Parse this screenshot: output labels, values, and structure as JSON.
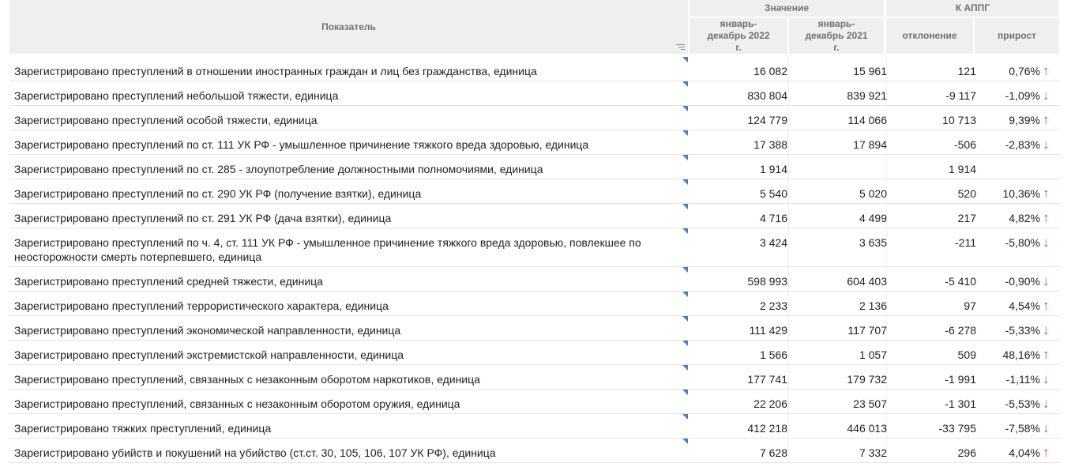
{
  "header": {
    "indicator": "Показатель",
    "value_group": "Значение",
    "appg_group": "К АППГ",
    "period_2022": "январь-декабрь 2022 г.",
    "period_2021": "январь-декабрь 2021 г.",
    "deviation": "отклонение",
    "growth": "прирост"
  },
  "colors": {
    "up": "#e53935",
    "down": "#43a047",
    "header_bg": "#efefef",
    "corner": "#4a7fc1"
  },
  "rows": [
    {
      "name": "Зарегистрировано преступлений в отношении иностранных граждан и лиц без гражданства, единица",
      "v2022": "16 082",
      "v2021": "15 961",
      "deviation": "121",
      "growth": "0,76%",
      "trend": "up"
    },
    {
      "name": "Зарегистрировано преступлений небольшой тяжести, единица",
      "v2022": "830 804",
      "v2021": "839 921",
      "deviation": "-9 117",
      "growth": "-1,09%",
      "trend": "down"
    },
    {
      "name": "Зарегистрировано преступлений особой тяжести, единица",
      "v2022": "124 779",
      "v2021": "114 066",
      "deviation": "10 713",
      "growth": "9,39%",
      "trend": "up"
    },
    {
      "name": "Зарегистрировано преступлений по ст. 111 УК РФ - умышленное причинение тяжкого вреда здоровью, единица",
      "v2022": "17 388",
      "v2021": "17 894",
      "deviation": "-506",
      "growth": "-2,83%",
      "trend": "down"
    },
    {
      "name": "Зарегистрировано преступлений по ст. 285 - злоупотребление должностными полномочиями, единица",
      "v2022": "1 914",
      "v2021": "",
      "deviation": "1 914",
      "growth": "",
      "trend": "none"
    },
    {
      "name": "Зарегистрировано преступлений по ст. 290 УК РФ (получение взятки), единица",
      "v2022": "5 540",
      "v2021": "5 020",
      "deviation": "520",
      "growth": "10,36%",
      "trend": "up"
    },
    {
      "name": "Зарегистрировано преступлений по ст. 291 УК РФ (дача взятки), единица",
      "v2022": "4 716",
      "v2021": "4 499",
      "deviation": "217",
      "growth": "4,82%",
      "trend": "up"
    },
    {
      "name": "Зарегистрировано преступлений по ч. 4, ст. 111 УК РФ - умышленное причинение тяжкого вреда здоровью, повлекшее по неосторожности смерть потерпевшего, единица",
      "v2022": "3 424",
      "v2021": "3 635",
      "deviation": "-211",
      "growth": "-5,80%",
      "trend": "down"
    },
    {
      "name": "Зарегистрировано преступлений средней тяжести, единица",
      "v2022": "598 993",
      "v2021": "604 403",
      "deviation": "-5 410",
      "growth": "-0,90%",
      "trend": "down"
    },
    {
      "name": "Зарегистрировано преступлений террористического характера, единица",
      "v2022": "2 233",
      "v2021": "2 136",
      "deviation": "97",
      "growth": "4,54%",
      "trend": "up"
    },
    {
      "name": "Зарегистрировано преступлений экономической направленности, единица",
      "v2022": "111 429",
      "v2021": "117 707",
      "deviation": "-6 278",
      "growth": "-5,33%",
      "trend": "down"
    },
    {
      "name": "Зарегистрировано преступлений экстремистской направленности, единица",
      "v2022": "1 566",
      "v2021": "1 057",
      "deviation": "509",
      "growth": "48,16%",
      "trend": "up"
    },
    {
      "name": "Зарегистрировано преступлений, связанных с незаконным оборотом наркотиков, единица",
      "v2022": "177 741",
      "v2021": "179 732",
      "deviation": "-1 991",
      "growth": "-1,11%",
      "trend": "down"
    },
    {
      "name": "Зарегистрировано преступлений, связанных с незаконным оборотом оружия, единица",
      "v2022": "22 206",
      "v2021": "23 507",
      "deviation": "-1 301",
      "growth": "-5,53%",
      "trend": "down"
    },
    {
      "name": "Зарегистрировано тяжких преступлений, единица",
      "v2022": "412 218",
      "v2021": "446 013",
      "deviation": "-33 795",
      "growth": "-7,58%",
      "trend": "down"
    },
    {
      "name": "Зарегистрировано убийств и покушений на убийство (ст.ст. 30, 105, 106, 107 УК РФ), единица",
      "v2022": "7 628",
      "v2021": "7 332",
      "deviation": "296",
      "growth": "4,04%",
      "trend": "up"
    }
  ]
}
